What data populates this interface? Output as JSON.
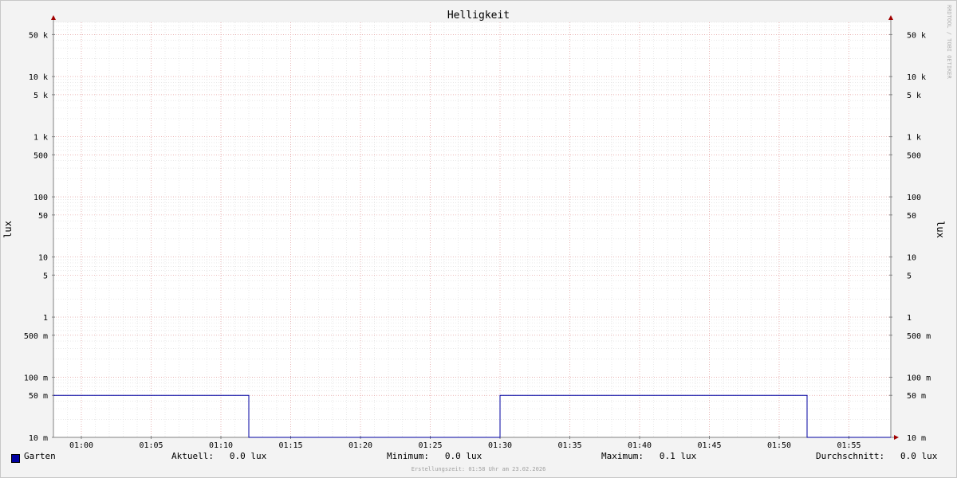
{
  "chart_data": {
    "type": "line",
    "title": "Helligkeit",
    "ylabel": "lux",
    "yscale": "log",
    "ylim": [
      0.01,
      80000
    ],
    "y_ticks": [
      {
        "value": 50000,
        "label": "50 k"
      },
      {
        "value": 10000,
        "label": "10 k"
      },
      {
        "value": 5000,
        "label": "5 k"
      },
      {
        "value": 1000,
        "label": "1 k"
      },
      {
        "value": 500,
        "label": "500"
      },
      {
        "value": 100,
        "label": "100"
      },
      {
        "value": 50,
        "label": "50"
      },
      {
        "value": 10,
        "label": "10"
      },
      {
        "value": 5,
        "label": "5"
      },
      {
        "value": 1,
        "label": "1"
      },
      {
        "value": 0.5,
        "label": "500 m"
      },
      {
        "value": 0.1,
        "label": "100 m"
      },
      {
        "value": 0.05,
        "label": "50 m"
      },
      {
        "value": 0.01,
        "label": "10 m"
      }
    ],
    "x_ticks": [
      "01:00",
      "01:05",
      "01:10",
      "01:15",
      "01:20",
      "01:25",
      "01:30",
      "01:35",
      "01:40",
      "01:45",
      "01:50",
      "01:55"
    ],
    "xlim": [
      "00:58",
      "01:58"
    ],
    "grid": true,
    "series": [
      {
        "name": "Garten",
        "color": "#0000a0",
        "points": [
          [
            "00:58",
            0.05
          ],
          [
            "01:12",
            0.05
          ],
          [
            "01:12",
            0.01
          ],
          [
            "01:30",
            0.01
          ],
          [
            "01:30",
            0.05
          ],
          [
            "01:52",
            0.05
          ],
          [
            "01:52",
            0.01
          ],
          [
            "01:58",
            0.01
          ]
        ]
      }
    ]
  },
  "legend": {
    "series_name": "Garten",
    "current": "Aktuell:   0.0 lux",
    "minimum": "Minimum:   0.0 lux",
    "maximum": "Maximum:   0.1 lux",
    "average": "Durchschnitt:   0.0 lux"
  },
  "footer": "Erstellungszeit: 01:58 Uhr am 23.02.2026",
  "watermark": "RRDTOOL / TOBI OETIKER"
}
